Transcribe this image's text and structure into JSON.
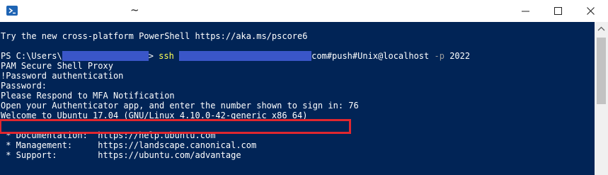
{
  "window": {
    "title": "~",
    "icon": "powershell-icon",
    "controls": {
      "minimize": "minimize-icon",
      "maximize": "maximize-icon",
      "close": "close-icon"
    }
  },
  "terminal": {
    "background": "#012456",
    "intro": "Try the new cross-platform PowerShell https://aka.ms/pscore6",
    "prompt": {
      "ps_prefix": "PS C:\\Users\\",
      "ps_suffix": ">",
      "command": "ssh",
      "args_suffix": "com#push#Unix@localhost",
      "port_flag": "-p",
      "port": "2022"
    },
    "lines": [
      "PAM Secure Shell Proxy",
      "!Password authentication",
      "Password:",
      "Please Respond to MFA Notification",
      "Open your Authenticator app, and enter the number shown to sign in: 76",
      "Welcome to Ubuntu 17.04 (GNU/Linux 4.10.0-42-generic x86_64)",
      "",
      " * Documentation:  https://help.ubuntu.com",
      " * Management:     https://landscape.canonical.com",
      " * Support:        https://ubuntu.com/advantage"
    ],
    "highlight_color": "#e0272f"
  }
}
